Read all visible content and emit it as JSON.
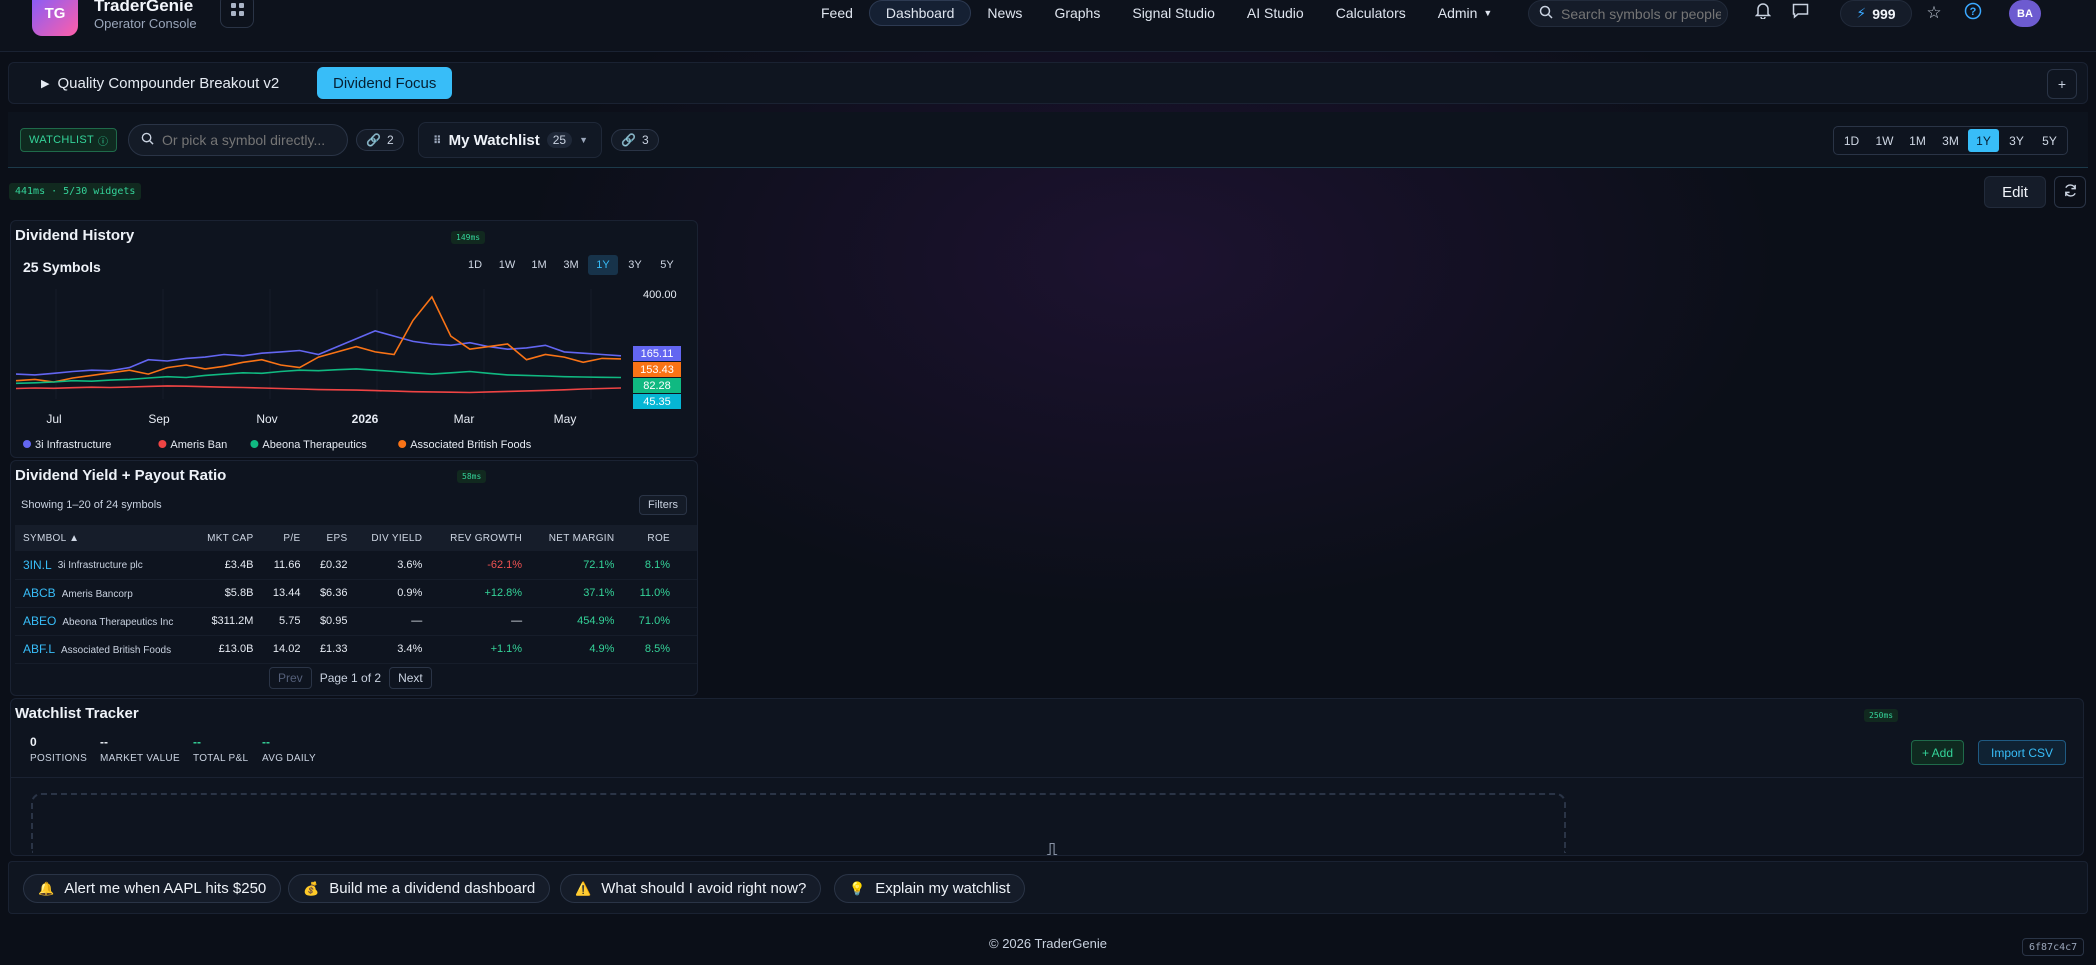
{
  "header": {
    "logo_initials": "TG",
    "brand": "TraderGenie",
    "subtitle": "Operator Console",
    "nav": [
      {
        "label": "Feed",
        "active": false
      },
      {
        "label": "Dashboard",
        "active": true
      },
      {
        "label": "News",
        "active": false
      },
      {
        "label": "Graphs",
        "active": false
      },
      {
        "label": "Signal Studio",
        "active": false
      },
      {
        "label": "AI Studio",
        "active": false
      },
      {
        "label": "Calculators",
        "active": false
      },
      {
        "label": "Admin",
        "active": false
      }
    ],
    "search_placeholder": "Search symbols or people...",
    "credits": "999",
    "avatar_initials": "BA"
  },
  "strategies": {
    "items": [
      {
        "label": "Quality Compounder Breakout v2",
        "active": false
      },
      {
        "label": "Dividend Focus",
        "active": true
      }
    ]
  },
  "watchlist_bar": {
    "badge": "WATCHLIST",
    "pick_placeholder": "Or pick a symbol directly...",
    "links_count": "2",
    "watchlist_name": "My Watchlist",
    "watchlist_count": "25",
    "shared_count": "3",
    "ranges": [
      "1D",
      "1W",
      "1M",
      "3M",
      "1Y",
      "3Y",
      "5Y"
    ],
    "active_range": "1Y"
  },
  "perf_badge": "441ms · 5/30 widgets",
  "edit_label": "Edit",
  "dividend_history": {
    "title": "Dividend History",
    "timing": "149ms",
    "subtitle": "25 Symbols",
    "ranges": [
      "1D",
      "1W",
      "1M",
      "3M",
      "1Y",
      "3Y",
      "5Y"
    ],
    "active_range": "1Y",
    "legend": [
      {
        "name": "3i Infrastructure",
        "color": "#6366f1"
      },
      {
        "name": "Ameris Ban",
        "color": "#ef4444"
      },
      {
        "name": "Abeona Therapeutics",
        "color": "#10b981"
      },
      {
        "name": "Associated British Foods",
        "color": "#f97316"
      }
    ]
  },
  "chart_data": {
    "type": "line",
    "x_ticks": [
      "Jul",
      "Sep",
      "Nov",
      "2026",
      "Mar",
      "May"
    ],
    "y_ticks": [
      400.0
    ],
    "last_values": [
      {
        "label": "165.11",
        "color": "#6366f1"
      },
      {
        "label": "153.43",
        "color": "#f97316"
      },
      {
        "label": "82.28",
        "color": "#10b981"
      },
      {
        "label": "45.35",
        "color": "#06b6d4"
      }
    ],
    "series": [
      {
        "name": "3i Infrastructure",
        "color": "#6366f1",
        "values": [
          95,
          92,
          98,
          105,
          110,
          108,
          120,
          150,
          145,
          155,
          160,
          170,
          165,
          175,
          180,
          185,
          170,
          200,
          230,
          260,
          240,
          220,
          210,
          205,
          215,
          200,
          190,
          195,
          205,
          180,
          175,
          170,
          165
        ]
      },
      {
        "name": "Associated British Foods",
        "color": "#f97316",
        "values": [
          70,
          75,
          65,
          80,
          90,
          100,
          110,
          95,
          120,
          130,
          115,
          125,
          140,
          150,
          130,
          120,
          160,
          180,
          200,
          180,
          170,
          300,
          390,
          240,
          190,
          200,
          210,
          150,
          170,
          160,
          140,
          155,
          153
        ]
      },
      {
        "name": "Abeona Therapeutics",
        "color": "#10b981",
        "values": [
          60,
          62,
          65,
          70,
          68,
          72,
          75,
          80,
          85,
          82,
          90,
          95,
          100,
          98,
          105,
          110,
          108,
          112,
          115,
          110,
          105,
          100,
          95,
          100,
          105,
          98,
          92,
          90,
          88,
          85,
          84,
          83,
          82
        ]
      },
      {
        "name": "Ameris Ban",
        "color": "#ef4444",
        "values": [
          40,
          42,
          41,
          43,
          45,
          44,
          46,
          48,
          50,
          49,
          47,
          45,
          44,
          42,
          40,
          38,
          36,
          35,
          34,
          32,
          30,
          28,
          27,
          26,
          25,
          27,
          29,
          31,
          33,
          35,
          38,
          40,
          42
        ]
      }
    ]
  },
  "yield_table": {
    "title": "Dividend Yield + Payout Ratio",
    "timing": "58ms",
    "meta": "Showing 1–20 of 24 symbols",
    "filters_label": "Filters",
    "columns": [
      "SYMBOL ▲",
      "MKT CAP",
      "P/E",
      "EPS",
      "DIV YIELD",
      "REV GROWTH",
      "NET MARGIN",
      "ROE"
    ],
    "rows": [
      {
        "symbol": "3IN.L",
        "name": "3i Infrastructure plc",
        "mkt_cap": "£3.4B",
        "pe": "11.66",
        "eps": "£0.32",
        "div_yield": "3.6%",
        "rev_growth": "-62.1%",
        "rev_sign": "neg",
        "net_margin": "72.1%",
        "roe": "8.1%"
      },
      {
        "symbol": "ABCB",
        "name": "Ameris Bancorp",
        "mkt_cap": "$5.8B",
        "pe": "13.44",
        "eps": "$6.36",
        "div_yield": "0.9%",
        "rev_growth": "+12.8%",
        "rev_sign": "pos",
        "net_margin": "37.1%",
        "roe": "11.0%"
      },
      {
        "symbol": "ABEO",
        "name": "Abeona Therapeutics Inc",
        "mkt_cap": "$311.2M",
        "pe": "5.75",
        "eps": "$0.95",
        "div_yield": "—",
        "rev_growth": "—",
        "rev_sign": "none",
        "net_margin": "454.9%",
        "roe": "71.0%"
      },
      {
        "symbol": "ABF.L",
        "name": "Associated British Foods",
        "mkt_cap": "£13.0B",
        "pe": "14.02",
        "eps": "£1.33",
        "div_yield": "3.4%",
        "rev_growth": "+1.1%",
        "rev_sign": "pos",
        "net_margin": "4.9%",
        "roe": "8.5%"
      }
    ],
    "pager": {
      "prev": "Prev",
      "label": "Page 1 of 2",
      "next": "Next"
    }
  },
  "tracker": {
    "title": "Watchlist Tracker",
    "timing": "250ms",
    "stats": [
      {
        "value": "0",
        "label": "POSITIONS"
      },
      {
        "value": "--",
        "label": "MARKET VALUE"
      },
      {
        "value": "--",
        "label": "TOTAL P&L"
      },
      {
        "value": "--",
        "label": "AVG DAILY"
      }
    ],
    "add_label": "+ Add",
    "import_label": "Import CSV"
  },
  "quick_prompts": [
    {
      "icon": "🔔",
      "label": "Alert me when AAPL hits $250"
    },
    {
      "icon": "💰",
      "label": "Build me a dividend dashboard"
    },
    {
      "icon": "⚠️",
      "label": "What should I avoid right now?"
    },
    {
      "icon": "💡",
      "label": "Explain my watchlist"
    }
  ],
  "footer": {
    "copyright": "© 2026 TraderGenie",
    "build": "6f87c4c7"
  }
}
